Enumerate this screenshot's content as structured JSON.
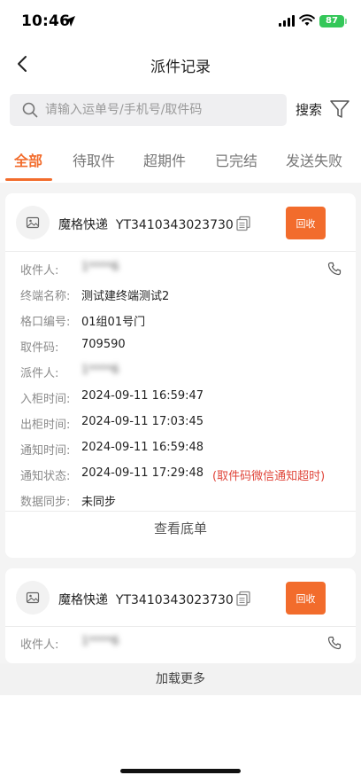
{
  "status_bar": {
    "time": "10:46",
    "battery": "87"
  },
  "nav": {
    "title": "派件记录"
  },
  "search": {
    "placeholder": "请输入运单号/手机号/取件码",
    "button_label": "搜索"
  },
  "tabs": [
    {
      "label": "全部",
      "active": true
    },
    {
      "label": "待取件",
      "active": false
    },
    {
      "label": "超期件",
      "active": false
    },
    {
      "label": "已完结",
      "active": false
    },
    {
      "label": "发送失败",
      "active": false
    }
  ],
  "cards": [
    {
      "courier": "魔格快递",
      "tracking": "YT3410343023730",
      "recall_label": "回收",
      "rows": [
        {
          "label": "收件人:",
          "value": "1****6"
        },
        {
          "label": "终端名称:",
          "value": "测试建终端测试2"
        },
        {
          "label": "格口编号:",
          "value": "01组01号门"
        },
        {
          "label": "取件码:",
          "value": "709590"
        },
        {
          "label": "派件人:",
          "value": "1****6"
        },
        {
          "label": "入柜时间:",
          "value": "2024-09-11 16:59:47"
        },
        {
          "label": "出柜时间:",
          "value": "2024-09-11 17:03:45"
        },
        {
          "label": "通知时间:",
          "value": "2024-09-11 16:59:48"
        },
        {
          "label": "通知状态:",
          "value": "2024-09-11 17:29:48",
          "note": "(取件码微信通知超时)"
        },
        {
          "label": "数据同步:",
          "value": "未同步"
        }
      ],
      "view_receipt_label": "查看底单"
    },
    {
      "courier": "魔格快递",
      "tracking": "YT3410343023730",
      "recall_label": "回收",
      "rows": [
        {
          "label": "收件人:",
          "value": "1****6"
        }
      ]
    }
  ],
  "load_more_label": "加载更多",
  "colors": {
    "accent": "#f26c2c",
    "warning_text": "#e0453a",
    "battery": "#34c759"
  }
}
